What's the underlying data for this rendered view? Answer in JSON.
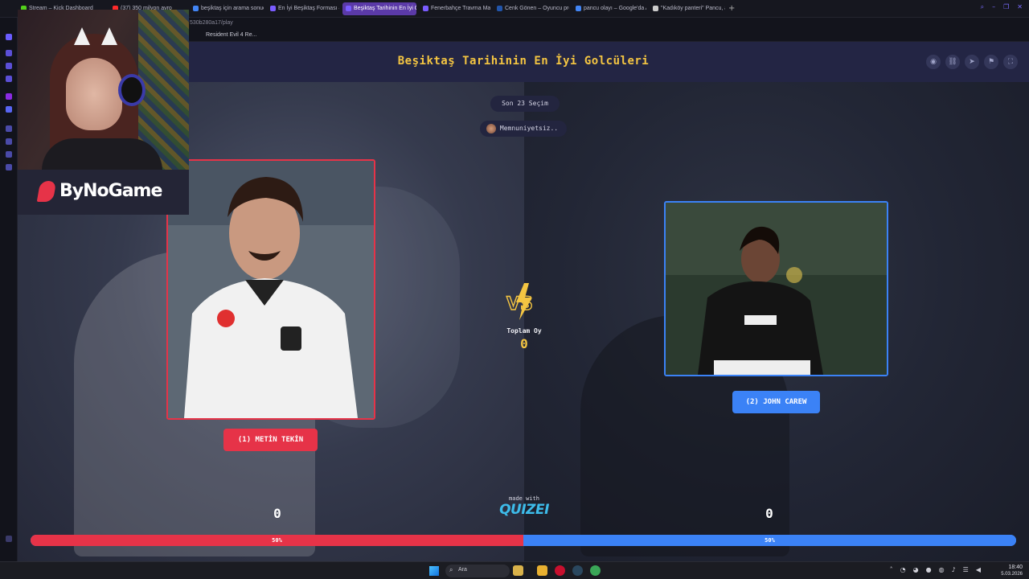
{
  "browser": {
    "tabs": [
      {
        "label": "Stream – Kick Dashboard",
        "color": "#52d01b"
      },
      {
        "label": "(37) 350 milyon avro",
        "color": "#ff2a2a"
      },
      {
        "label": "beşiktaş için arama sonuç",
        "color": "#4285f4"
      },
      {
        "label": "En İyi Beşiktaş Forması – T",
        "color": "#7a5cff"
      },
      {
        "label": "Beşiktaş Tarihinin En İyi G",
        "color": "#7a5cff",
        "active": true
      },
      {
        "label": "Fenerbahçe Travma Maçla",
        "color": "#7a5cff"
      },
      {
        "label": "Cenk Gönen – Oyuncu pro",
        "color": "#2255aa"
      },
      {
        "label": "pancu olayı – Google'da A",
        "color": "#4285f4"
      },
      {
        "label": "\"Kadıköy panteri\" Pancu, a",
        "color": "#cccccc"
      }
    ],
    "new_tab": "+",
    "address": "530b280a17/play",
    "bookmark": "Resident Evil 4 Re...",
    "ai_label": "AI",
    "window_controls": [
      "–",
      "❐",
      "✕"
    ]
  },
  "header": {
    "title": "Beşiktaş Tarihinin En İyi Golcüleri",
    "icons": [
      "eye-icon",
      "link-icon",
      "send-icon",
      "flag-icon",
      "fullscreen-icon"
    ]
  },
  "round": {
    "last_label": "Son 23 Seçim",
    "user_name": "Memnuniyetsiz.."
  },
  "left": {
    "button_label": "(1) METİN TEKİN",
    "score": "0",
    "percent_label": "50%",
    "percent": 50,
    "color": "#e63348"
  },
  "right": {
    "button_label": "(2) JOHN CAREW",
    "score": "0",
    "percent_label": "50%",
    "percent": 50,
    "color": "#3b82f6"
  },
  "center": {
    "vs_text": "VS",
    "total_label": "Toplam Oy",
    "total_value": "0"
  },
  "footer": {
    "made_with": "made with",
    "brand": "QUIZEI"
  },
  "overlay": {
    "logo_text": "ByNoGame"
  },
  "taskbar": {
    "search_placeholder": "Ara",
    "time": "18:40",
    "date": "5.03.2026"
  }
}
